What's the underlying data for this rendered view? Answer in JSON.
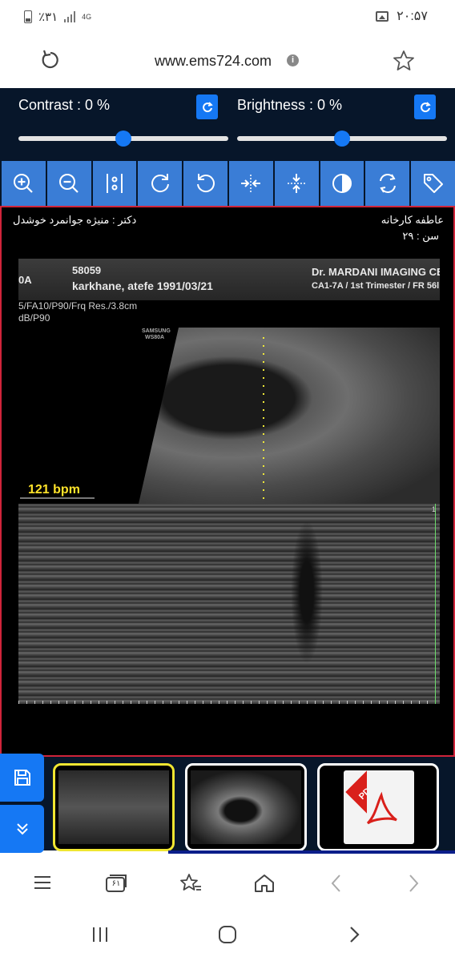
{
  "status_bar": {
    "battery_text": "٪۳۱",
    "network": "4G",
    "time": "۲۰:۵۷"
  },
  "url_bar": {
    "url": "www.ems724.com",
    "info_label": "i"
  },
  "controls": {
    "contrast_label": "Contrast : 0 %",
    "brightness_label": "Brightness : 0 %",
    "contrast_value": 0,
    "brightness_value": 0
  },
  "toolbar": {
    "tools": [
      "zoom-in-icon",
      "zoom-out-icon",
      "fit-icon",
      "rotate-right-icon",
      "rotate-left-icon",
      "flip-horizontal-icon",
      "flip-vertical-icon",
      "invert-icon",
      "reset-icon",
      "tag-icon"
    ]
  },
  "study": {
    "patient_name": "عاطفه کارخانه",
    "age": "سن : ۲۹",
    "doctor": "دکتر : منیژه جوانمرد خوشدل"
  },
  "ultrasound": {
    "left_code": "0A",
    "study_id": "58059",
    "patient_line": "karkhane, atefe 1991/03/21",
    "clinic": "Dr. MARDANI IMAGING CE",
    "probe_info": "CA1-7A / 1st Trimester / FR 56l",
    "param_line1": "5/FA10/P90/Frq Res./3.8cm",
    "param_line2": "dB/P90",
    "device_brand": "SAMSUNG",
    "device_model": "WS80A",
    "heart_rate": "121 bpm",
    "marker": "1"
  },
  "thumbnails": {
    "pdf_label": "PDF",
    "selected_index": 0
  },
  "browser_bar": {
    "tabs_count": "۶۱"
  }
}
